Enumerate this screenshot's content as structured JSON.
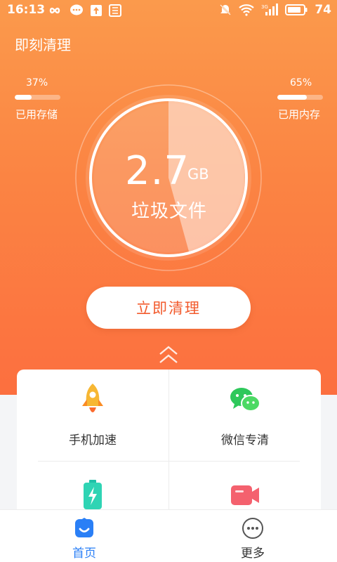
{
  "status_bar": {
    "time": "16:13",
    "battery": "74",
    "left_icons": [
      "infinity-icon",
      "message-icon",
      "upload-icon",
      "app-icon"
    ],
    "right_icons": [
      "mute-icon",
      "wifi-icon",
      "signal-3g-icon",
      "battery-icon"
    ]
  },
  "header": {
    "title": "即刻清理"
  },
  "storage": {
    "percent_text": "37%",
    "value": 0.37,
    "label": "已用存储"
  },
  "memory": {
    "percent_text": "65%",
    "value": 0.65,
    "label": "已用内存"
  },
  "gauge": {
    "value": "2.7",
    "unit": "GB",
    "label": "垃圾文件"
  },
  "clean_button": {
    "label": "立即清理"
  },
  "features": [
    {
      "name": "手机加速",
      "icon": "rocket-icon"
    },
    {
      "name": "微信专清",
      "icon": "wechat-icon"
    },
    {
      "name": "",
      "icon": "battery-charge-icon"
    },
    {
      "name": "",
      "icon": "video-icon"
    }
  ],
  "tabs": [
    {
      "label": "首页",
      "icon": "home-icon",
      "active": true
    },
    {
      "label": "更多",
      "icon": "more-icon",
      "active": false
    }
  ],
  "colors": {
    "accent": "#f25a2c",
    "tab_active": "#2a7ff6",
    "tab_inactive": "#555555",
    "hero_top": "#fb9a4c",
    "hero_bottom": "#fc6f3f"
  }
}
